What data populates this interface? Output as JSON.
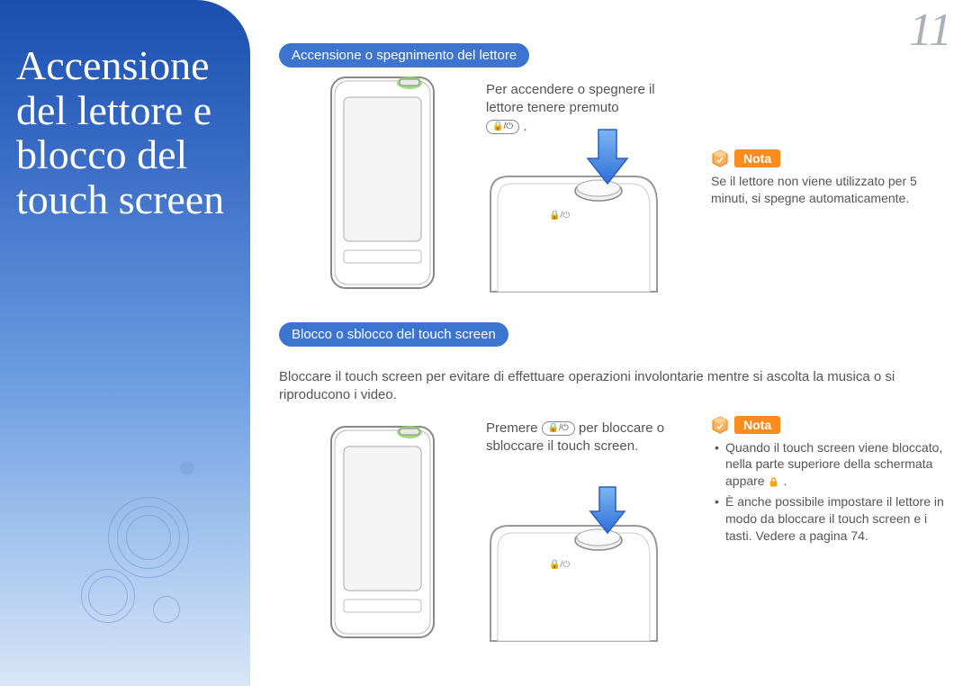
{
  "page_number": "11",
  "sidebar_title": "Accensione del lettore e blocco del touch screen",
  "section1": {
    "heading": "Accensione o spegnimento del lettore",
    "instruction_pre": "Per accendere o spegnere il lettore tenere premuto",
    "button_symbol": "🔒/⏻",
    "instruction_post": ".",
    "note_label": "Nota",
    "note_text": "Se il lettore non viene utilizzato per 5 minuti, si spegne automaticamente."
  },
  "section2": {
    "heading": "Blocco o sblocco del touch screen",
    "intro": "Bloccare il touch screen per evitare di effettuare operazioni involontarie mentre si ascolta la musica o si riproducono i video.",
    "instruction_pre": "Premere ",
    "button_symbol": "🔒/⏻",
    "instruction_post": " per bloccare o sbloccare il touch screen.",
    "note_label": "Nota",
    "note_bullet1_pre": "Quando il touch screen viene bloccato, nella parte superiore della schermata appare ",
    "note_bullet1_post": ".",
    "note_bullet2": "È anche possibile impostare il lettore in modo da bloccare il touch screen e i tasti. Vedere a pagina 74."
  }
}
